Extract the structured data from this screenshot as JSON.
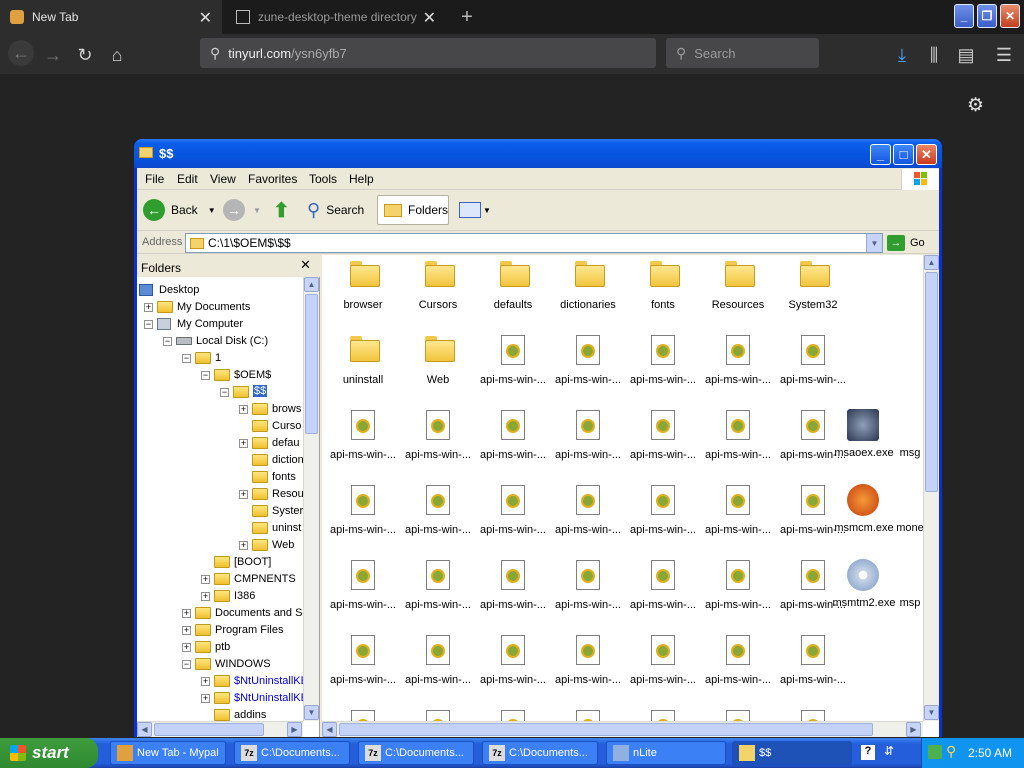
{
  "browser": {
    "tabs": [
      {
        "title": "New Tab"
      },
      {
        "title": "zune-desktop-theme directory lis"
      }
    ],
    "url_domain": "tinyurl.com",
    "url_path": "/ysn6yfb7",
    "search_placeholder": "Search"
  },
  "explorer": {
    "title": "$$",
    "menu": [
      "File",
      "Edit",
      "View",
      "Favorites",
      "Tools",
      "Help"
    ],
    "toolbar": {
      "back": "Back",
      "search": "Search",
      "folders": "Folders"
    },
    "address_label": "Address",
    "address_value": "C:\\1\\$OEM$\\$$",
    "go_label": "Go",
    "folders_pane_title": "Folders",
    "tree": [
      "Desktop",
      "My Documents",
      "My Computer",
      "Local Disk (C:)",
      "1",
      "$OEM$",
      "$$",
      "brows",
      "Curso",
      "defau",
      "diction",
      "fonts",
      "Resou",
      "Syster",
      "uninst",
      "Web",
      "[BOOT]",
      "CMPNENTS",
      "I386",
      "Documents and Se",
      "Program Files",
      "ptb",
      "WINDOWS",
      "$NtUninstallKE",
      "$NtUninstallKE",
      "addins"
    ],
    "items": [
      "browser",
      "Cursors",
      "defaults",
      "dictionaries",
      "fonts",
      "Resources",
      "System32",
      "uninstall",
      "Web",
      "api-ms-win-...",
      "api-ms-win-...",
      "api-ms-win-...",
      "api-ms-win-...",
      "api-ms-win-...",
      "api-ms-win-...",
      "api-ms-win-...",
      "api-ms-win-...",
      "api-ms-win-...",
      "api-ms-win-...",
      "api-ms-win-...",
      "api-ms-win-...",
      "api-ms-win-...",
      "api-ms-win-...",
      "api-ms-win-...",
      "api-ms-win-...",
      "api-ms-win-...",
      "api-ms-win-...",
      "api-ms-win-...",
      "api-ms-win-...",
      "api-ms-win-...",
      "api-ms-win-...",
      "api-ms-win-...",
      "api-ms-win-...",
      "api-ms-win-...",
      "api-ms-win-...",
      "api-ms-win-...",
      "api-ms-win-...",
      "api-ms-win-...",
      "api-ms-win-...",
      "api-ms-win-...",
      "api-ms-win-...",
      "api-ms-win-..."
    ],
    "extra_items": [
      "msaoex.exe",
      "msg",
      "msmcm.exe",
      "mone",
      "msmtm2.exe",
      "msp"
    ]
  },
  "taskbar": {
    "start_label": "start",
    "tasks": [
      "New Tab - Mypal",
      "C:\\Documents...",
      "C:\\Documents...",
      "C:\\Documents...",
      "nLite",
      "$$"
    ],
    "clock": "2:50 AM"
  },
  "colors": {
    "xp_blue": "#0a5ee9",
    "taskbar": "#245edb",
    "start_green": "#3e9c3e"
  }
}
